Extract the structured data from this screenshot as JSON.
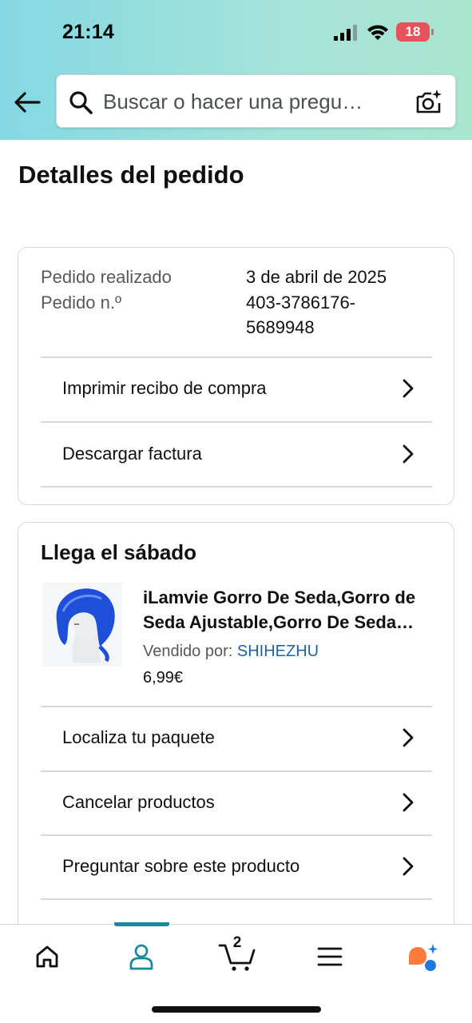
{
  "status_bar": {
    "time": "21:14",
    "battery": "18"
  },
  "search": {
    "placeholder": "Buscar o hacer una pregu…"
  },
  "page": {
    "title": "Detalles del pedido"
  },
  "order_info": {
    "placed_label": "Pedido realizado",
    "placed_value": "3 de abril de 2025",
    "number_label": "Pedido n.º",
    "number_value_line1": "403-3786176-",
    "number_value_line2": "5689948"
  },
  "order_actions": [
    {
      "label": "Imprimir recibo de compra"
    },
    {
      "label": "Descargar factura"
    }
  ],
  "shipment": {
    "arrives": "Llega el sábado",
    "product_title": "iLamvie Gorro De Seda,Gorro de Seda Ajustable,Gorro De Seda…",
    "sold_by_label": "Vendido por:",
    "seller": "SHIHEZHU",
    "price": "6,99€",
    "actions": [
      {
        "label": "Localiza tu paquete"
      },
      {
        "label": "Cancelar productos"
      },
      {
        "label": "Preguntar sobre este producto"
      }
    ]
  },
  "bottom_nav": {
    "cart_count": "2",
    "items": [
      "home-icon",
      "account-icon",
      "cart-icon",
      "menu-icon",
      "rufus-icon"
    ]
  },
  "colors": {
    "accent": "#1a8a99",
    "link": "#2162a1",
    "battery": "#e9525a"
  }
}
